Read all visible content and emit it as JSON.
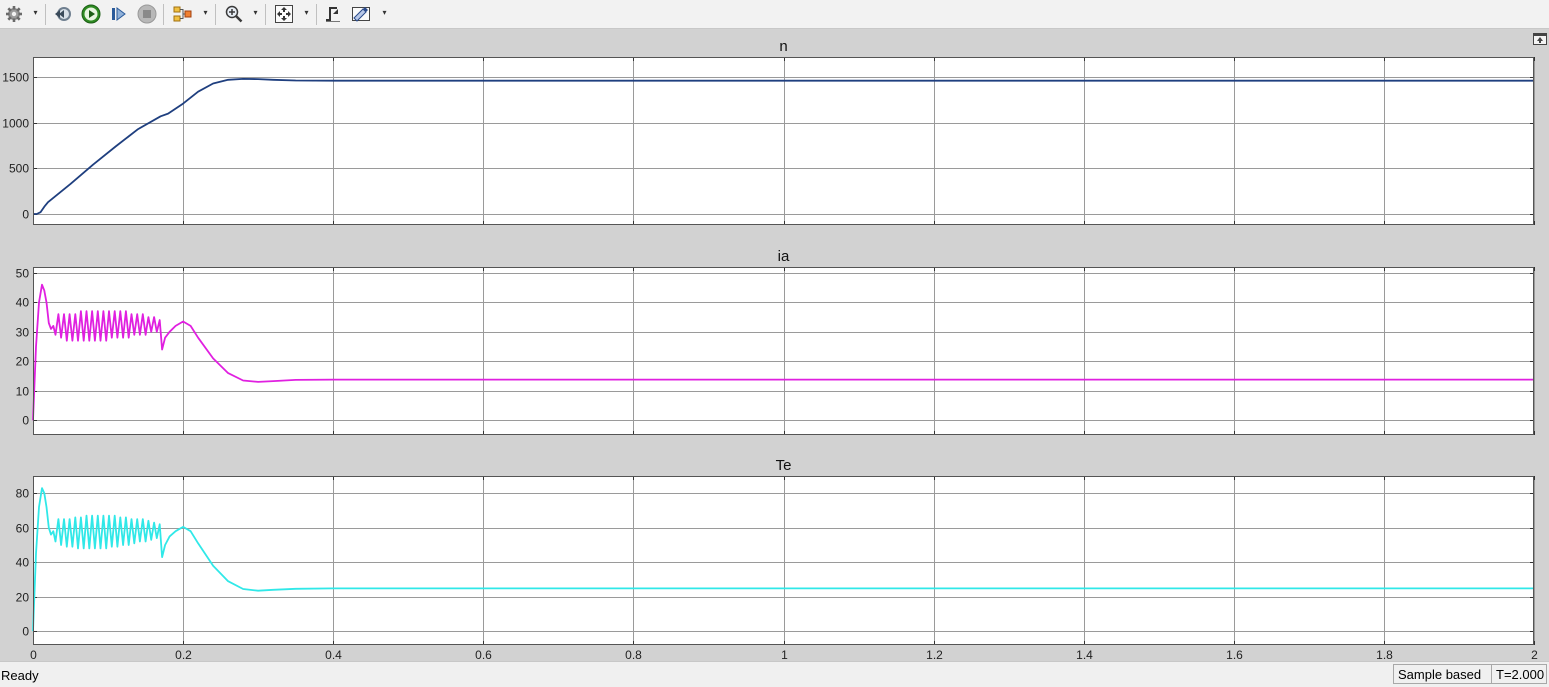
{
  "toolbar": {
    "items": [
      {
        "icon": "gear-icon",
        "dropdown": true
      },
      {
        "icon": "rewind-icon",
        "dropdown": false
      },
      {
        "icon": "run-icon",
        "dropdown": false
      },
      {
        "icon": "step-forward-icon",
        "dropdown": false
      },
      {
        "icon": "stop-icon",
        "dropdown": false
      },
      {
        "icon": "highlight-block-icon",
        "dropdown": true
      },
      {
        "icon": "zoom-icon",
        "dropdown": true
      },
      {
        "icon": "autoscale-icon",
        "dropdown": true
      },
      {
        "icon": "trigger-icon",
        "dropdown": false
      },
      {
        "icon": "measure-icon",
        "dropdown": true
      }
    ]
  },
  "status": {
    "text": "Ready",
    "mode": "Sample based",
    "time": "T=2.000"
  },
  "colors": {
    "plot_background": "#ffffff",
    "figure_background": "#d2d2d2",
    "grid": "#9a9a9a"
  },
  "chart_data": [
    {
      "type": "line",
      "title": "n",
      "xlim": [
        0,
        2
      ],
      "ylim": [
        -120,
        1720
      ],
      "yticks": [
        0,
        500,
        1000,
        1500
      ],
      "xticks": [
        0,
        0.2,
        0.4,
        0.6,
        0.8,
        1,
        1.2,
        1.4,
        1.6,
        1.8,
        2
      ],
      "xtick_labels": [],
      "grid": true,
      "series": [
        {
          "color": "#1f3f7f",
          "x": [
            0,
            0.005,
            0.01,
            0.015,
            0.02,
            0.05,
            0.08,
            0.11,
            0.14,
            0.17,
            0.18,
            0.2,
            0.22,
            0.24,
            0.26,
            0.28,
            0.3,
            0.32,
            0.35,
            0.4,
            0.5,
            0.7,
            1.0,
            1.5,
            2.0
          ],
          "y": [
            0,
            0,
            20,
            80,
            130,
            330,
            540,
            740,
            930,
            1070,
            1100,
            1210,
            1340,
            1430,
            1470,
            1480,
            1478,
            1470,
            1463,
            1460,
            1460,
            1460,
            1460,
            1460,
            1460
          ]
        }
      ]
    },
    {
      "type": "line",
      "title": "ia",
      "xlim": [
        0,
        2
      ],
      "ylim": [
        -5,
        52
      ],
      "yticks": [
        0,
        10,
        20,
        30,
        40,
        50
      ],
      "xticks": [
        0,
        0.2,
        0.4,
        0.6,
        0.8,
        1,
        1.2,
        1.4,
        1.6,
        1.8,
        2
      ],
      "xtick_labels": [],
      "grid": true,
      "series": [
        {
          "color": "#e020e0",
          "x": [
            0,
            0.004,
            0.008,
            0.012,
            0.015,
            0.018,
            0.021,
            0.024,
            0.027,
            0.03,
            0.0338,
            0.0375,
            0.0413,
            0.045,
            0.0488,
            0.0525,
            0.0563,
            0.06,
            0.0638,
            0.0675,
            0.0713,
            0.075,
            0.0788,
            0.0825,
            0.0863,
            0.09,
            0.0938,
            0.0975,
            0.1013,
            0.105,
            0.1088,
            0.1125,
            0.1163,
            0.12,
            0.1238,
            0.1275,
            0.1313,
            0.135,
            0.1388,
            0.1425,
            0.1463,
            0.15,
            0.1538,
            0.1575,
            0.1613,
            0.165,
            0.1688,
            0.172,
            0.176,
            0.182,
            0.19,
            0.2,
            0.21,
            0.22,
            0.24,
            0.26,
            0.28,
            0.3,
            0.32,
            0.35,
            0.4,
            0.5,
            0.7,
            1.0,
            1.5,
            2.0
          ],
          "y": [
            0,
            25,
            40,
            46,
            44,
            40,
            33,
            31,
            32,
            29,
            36,
            28,
            36,
            27,
            36,
            27,
            36,
            27,
            37,
            27,
            37,
            27,
            37,
            27,
            37,
            27,
            37,
            27,
            37,
            28,
            37,
            28,
            37,
            28,
            37,
            28,
            36,
            29,
            36,
            29,
            36,
            29,
            35,
            30,
            35,
            30,
            34,
            24,
            28,
            30,
            32,
            33.5,
            32,
            28,
            21,
            16,
            13.5,
            13,
            13.3,
            13.7,
            13.8,
            13.8,
            13.8,
            13.8,
            13.8,
            13.8
          ]
        }
      ]
    },
    {
      "type": "line",
      "title": "Te",
      "xlim": [
        0,
        2
      ],
      "ylim": [
        -8,
        90
      ],
      "yticks": [
        0,
        20,
        40,
        60,
        80
      ],
      "xticks": [
        0,
        0.2,
        0.4,
        0.6,
        0.8,
        1,
        1.2,
        1.4,
        1.6,
        1.8,
        2
      ],
      "xtick_labels": [
        "0",
        "0.2",
        "0.4",
        "0.6",
        "0.8",
        "1",
        "1.2",
        "1.4",
        "1.6",
        "1.8",
        "2"
      ],
      "grid": true,
      "series": [
        {
          "color": "#30e8e8",
          "x": [
            0,
            0.004,
            0.008,
            0.012,
            0.015,
            0.018,
            0.021,
            0.024,
            0.027,
            0.03,
            0.0338,
            0.0375,
            0.0413,
            0.045,
            0.0488,
            0.0525,
            0.0563,
            0.06,
            0.0638,
            0.0675,
            0.0713,
            0.075,
            0.0788,
            0.0825,
            0.0863,
            0.09,
            0.0938,
            0.0975,
            0.1013,
            0.105,
            0.1088,
            0.1125,
            0.1163,
            0.12,
            0.1238,
            0.1275,
            0.1313,
            0.135,
            0.1388,
            0.1425,
            0.1463,
            0.15,
            0.1538,
            0.1575,
            0.1613,
            0.165,
            0.1688,
            0.172,
            0.176,
            0.182,
            0.19,
            0.2,
            0.21,
            0.22,
            0.24,
            0.26,
            0.28,
            0.3,
            0.32,
            0.35,
            0.4,
            0.5,
            0.7,
            1.0,
            1.5,
            2.0
          ],
          "y": [
            0,
            45,
            72,
            83,
            80,
            72,
            60,
            56,
            58,
            52,
            65,
            50,
            65,
            49,
            65,
            49,
            66,
            48,
            66,
            48,
            67,
            48,
            67,
            48,
            67,
            48,
            67,
            48,
            67,
            49,
            67,
            49,
            66,
            50,
            66,
            50,
            65,
            51,
            65,
            52,
            65,
            52,
            64,
            53,
            63,
            54,
            62,
            43,
            50,
            55,
            58,
            60.5,
            58,
            51,
            38,
            29,
            24.5,
            23.5,
            24,
            24.6,
            24.8,
            24.8,
            24.8,
            24.8,
            24.8,
            24.8
          ]
        }
      ]
    }
  ]
}
